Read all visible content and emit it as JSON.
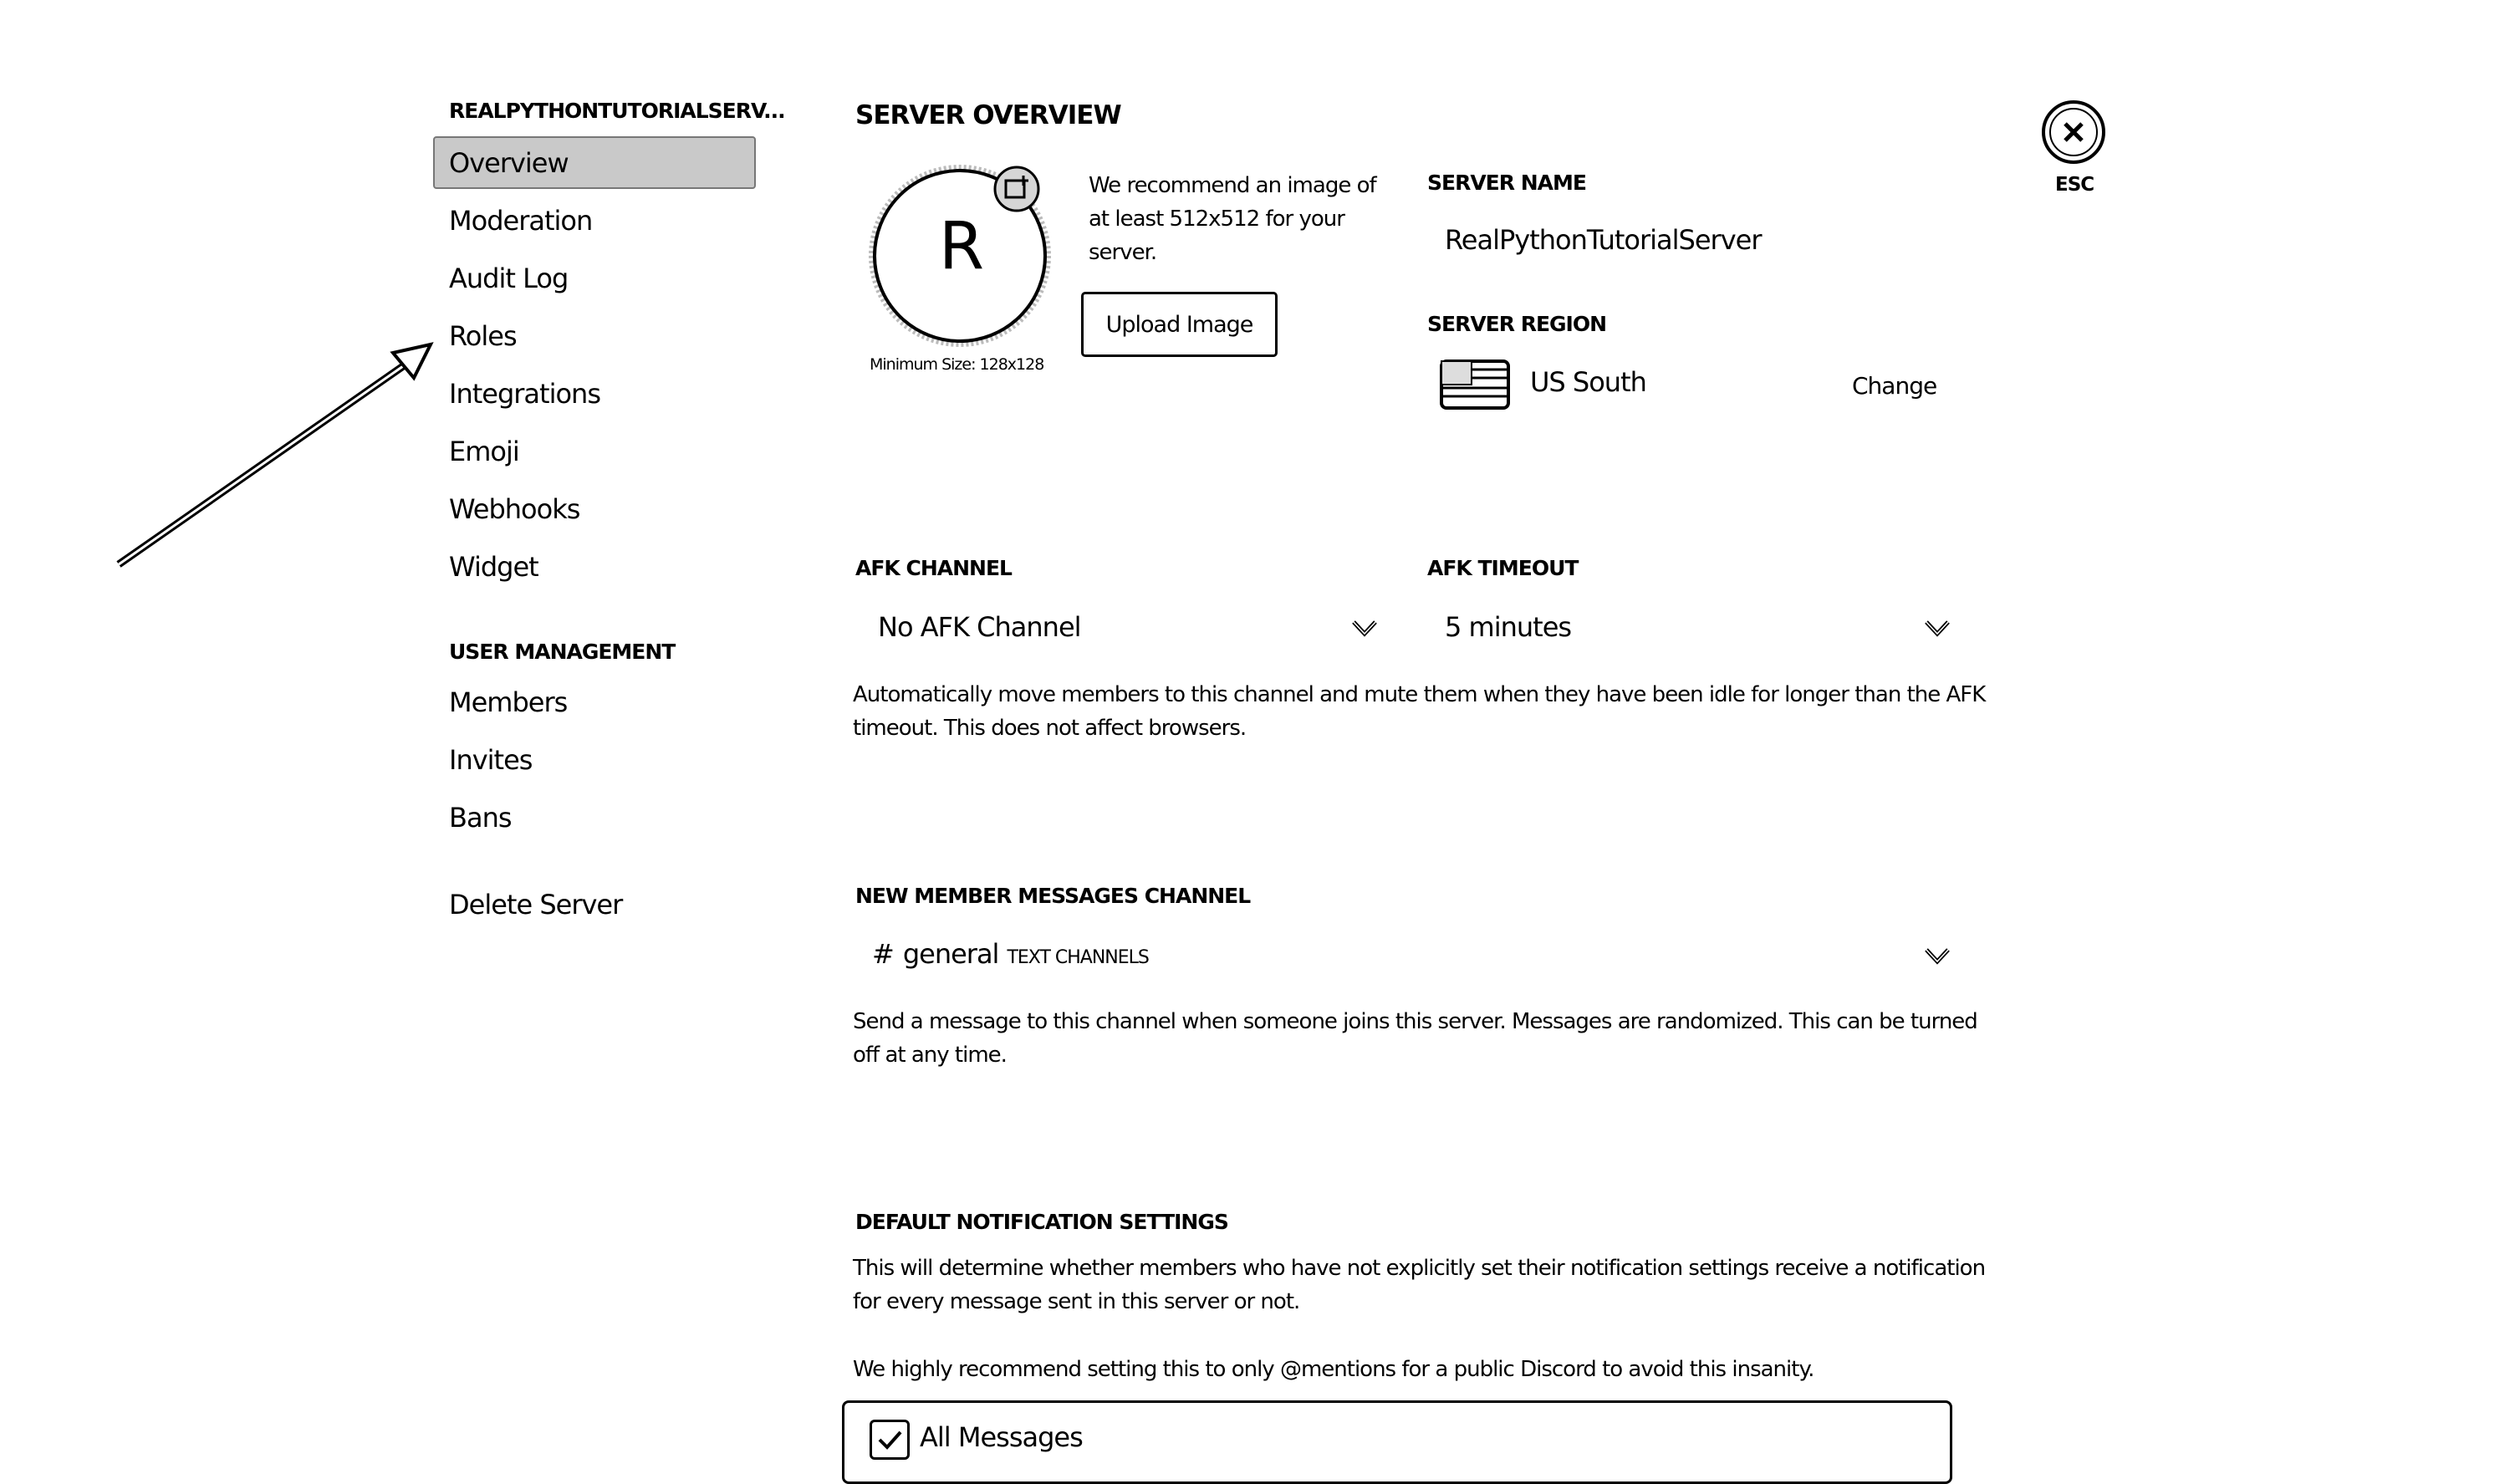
{
  "sidebar": {
    "server_header": "REALPYTHONTUTORIALSERV...",
    "items": [
      {
        "label": "Overview"
      },
      {
        "label": "Moderation"
      },
      {
        "label": "Audit Log"
      },
      {
        "label": "Roles"
      },
      {
        "label": "Integrations"
      },
      {
        "label": "Emoji"
      },
      {
        "label": "Webhooks"
      },
      {
        "label": "Widget"
      }
    ],
    "user_management_header": "USER MANAGEMENT",
    "user_items": [
      {
        "label": "Members"
      },
      {
        "label": "Invites"
      },
      {
        "label": "Bans"
      }
    ],
    "delete_server": "Delete Server"
  },
  "overview": {
    "title": "SERVER OVERVIEW",
    "icon_letter": "R",
    "min_size": "Minimum Size: 128x128",
    "recommend_text_1": "We recommend an image of",
    "recommend_text_2": "at least 512x512 for your",
    "recommend_text_3": "server.",
    "upload_button": "Upload Image",
    "server_name_label": "SERVER NAME",
    "server_name_value": "RealPythonTutorialServer",
    "server_region_label": "SERVER REGION",
    "server_region_value": "US South",
    "change_button": "Change",
    "close_label": "ESC"
  },
  "afk": {
    "channel_label": "AFK CHANNEL",
    "channel_value": "No AFK Channel",
    "timeout_label": "AFK TIMEOUT",
    "timeout_value": "5 minutes",
    "description_1": "Automatically move members to this channel and mute them when they have been idle for longer than the AFK",
    "description_2": "timeout. This does not affect browsers."
  },
  "new_member": {
    "label": "NEW MEMBER MESSAGES CHANNEL",
    "channel_hash": "#",
    "channel_value": "general",
    "channel_category": "TEXT CHANNELS",
    "description_1": "Send a message to this channel when someone joins this server. Messages are randomized. This can be turned",
    "description_2": "off at any time."
  },
  "notifications": {
    "label": "DEFAULT NOTIFICATION SETTINGS",
    "description_1": "This will determine whether members who have not explicitly set their notification settings receive a notification",
    "description_2": "for every message sent in this server or not.",
    "recommendation": "We highly recommend setting this to only @mentions for a public Discord to avoid this insanity.",
    "option_all_messages": "All Messages",
    "option_all_messages_checked": true
  }
}
